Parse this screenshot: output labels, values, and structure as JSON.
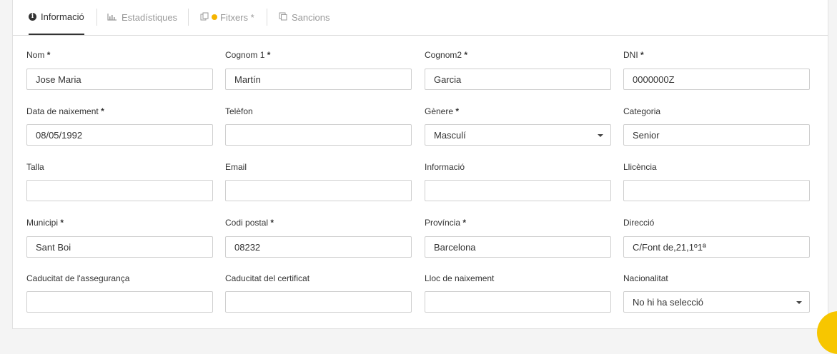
{
  "tabs": [
    {
      "label": "Informació",
      "icon": "info-circle-icon"
    },
    {
      "label": "Estadístiques",
      "icon": "bar-chart-icon"
    },
    {
      "label": "Fitxers *",
      "icon": "files-icon"
    },
    {
      "label": "Sancions",
      "icon": "copy-icon"
    }
  ],
  "fields": [
    {
      "label": "Nom",
      "required": "*",
      "value": "Jose Maria"
    },
    {
      "label": "Cognom 1",
      "required": "*",
      "value": "Martín"
    },
    {
      "label": "Cognom2",
      "required": "*",
      "value": "Garcia"
    },
    {
      "label": "DNI",
      "required": "*",
      "value": "0000000Z"
    },
    {
      "label": "Data de naixement",
      "required": "*",
      "value": "08/05/1992"
    },
    {
      "label": "Telèfon",
      "required": "",
      "value": ""
    },
    {
      "label": "Gènere",
      "required": "*",
      "value": "Masculí"
    },
    {
      "label": "Categoria",
      "required": "",
      "value": "Senior"
    },
    {
      "label": "Talla",
      "required": "",
      "value": ""
    },
    {
      "label": "Email",
      "required": "",
      "value": ""
    },
    {
      "label": "Informació",
      "required": "",
      "value": ""
    },
    {
      "label": "Llicència",
      "required": "",
      "value": ""
    },
    {
      "label": "Municipi",
      "required": "*",
      "value": "Sant Boi"
    },
    {
      "label": "Codi postal",
      "required": "*",
      "value": "08232"
    },
    {
      "label": "Província",
      "required": "*",
      "value": "Barcelona"
    },
    {
      "label": "Direcció",
      "required": "",
      "value": "C/Font de,21,1º1ª"
    },
    {
      "label": "Caducitat de l'assegurança",
      "required": "",
      "value": ""
    },
    {
      "label": "Caducitat del certificat",
      "required": "",
      "value": ""
    },
    {
      "label": "Lloc de naixement",
      "required": "",
      "value": ""
    },
    {
      "label": "Nacionalitat",
      "required": "",
      "value": "No hi ha selecció"
    }
  ],
  "colors": {
    "warning": "#f5b400",
    "active_tab": "#333333"
  }
}
